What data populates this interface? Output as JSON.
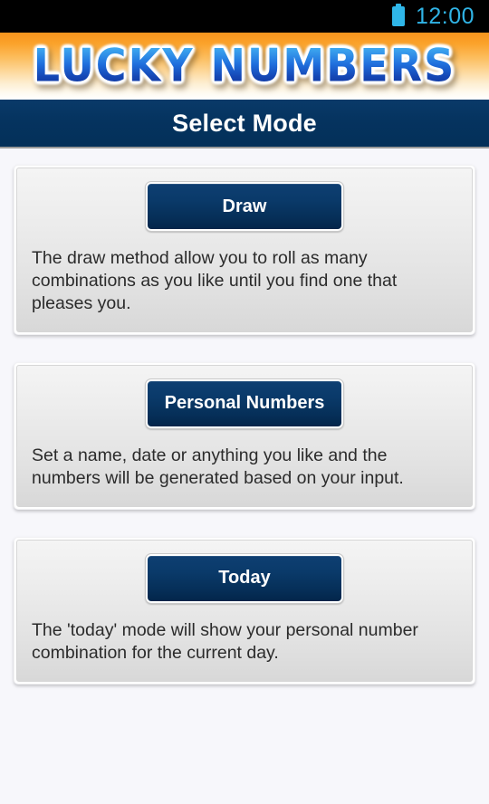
{
  "statusbar": {
    "battery_icon": "battery-full-icon",
    "clock": "12:00",
    "accent_color": "#30b4e6",
    "background_color": "#000000"
  },
  "banner": {
    "logo_text": "LUCKY NUMBERS",
    "gradient_from": "#f6941d",
    "gradient_to": "#ffffff",
    "logo_gradient_from": "#63c8f5",
    "logo_gradient_to": "#0e2f93"
  },
  "titlebar": {
    "title": "Select Mode",
    "background_color": "#05335f",
    "text_color": "#ffffff"
  },
  "page": {
    "background_color": "#f7f7fb",
    "card_button_color": "#0a3a6a"
  },
  "modes": [
    {
      "button_label": "Draw",
      "description": "The draw method allow you to roll as many combinations as you like until you find one that pleases you."
    },
    {
      "button_label": "Personal Numbers",
      "description": "Set a name, date or anything you like and the numbers will be generated based on your input."
    },
    {
      "button_label": "Today",
      "description": "The 'today' mode will show your personal number combination for the current day."
    }
  ]
}
